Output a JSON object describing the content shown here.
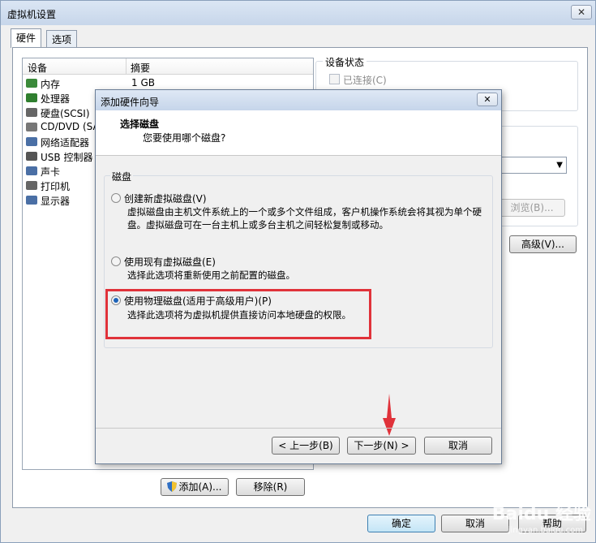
{
  "window": {
    "title": "虚拟机设置",
    "close_label": "✕"
  },
  "tabs": [
    {
      "label": "硬件"
    },
    {
      "label": "选项"
    }
  ],
  "device_list": {
    "headers": {
      "device": "设备",
      "summary": "摘要"
    },
    "items": [
      {
        "name": "内存",
        "summary": "1 GB",
        "icon": "memory-icon",
        "color": "#3a8a3a"
      },
      {
        "name": "处理器",
        "summary": "",
        "icon": "cpu-icon",
        "color": "#2f7f2f"
      },
      {
        "name": "硬盘(SCSI)",
        "summary": "",
        "icon": "harddisk-icon",
        "color": "#666666"
      },
      {
        "name": "CD/DVD (SA",
        "summary": "",
        "icon": "cdrom-icon",
        "color": "#777777"
      },
      {
        "name": "网络适配器",
        "summary": "",
        "icon": "network-icon",
        "color": "#4a6fa5"
      },
      {
        "name": "USB 控制器",
        "summary": "",
        "icon": "usb-icon",
        "color": "#555555"
      },
      {
        "name": "声卡",
        "summary": "",
        "icon": "speaker-icon",
        "color": "#4a6fa5"
      },
      {
        "name": "打印机",
        "summary": "",
        "icon": "printer-icon",
        "color": "#666666"
      },
      {
        "name": "显示器",
        "summary": "",
        "icon": "monitor-icon",
        "color": "#4a6fa5"
      }
    ]
  },
  "device_status": {
    "title": "设备状态",
    "connected_label": "已连接(C)"
  },
  "right_panel": {
    "browse_label": "浏览(B)...",
    "advanced_label": "高级(V)..."
  },
  "bottom_buttons": {
    "add_label": "添加(A)...",
    "remove_label": "移除(R)",
    "ok_label": "确定",
    "cancel_label": "取消",
    "help_label": "帮助"
  },
  "wizard": {
    "title": "添加硬件向导",
    "close_label": "✕",
    "heading": "选择磁盘",
    "subheading": "您要使用哪个磁盘?",
    "group_title": "磁盘",
    "options": [
      {
        "label": "创建新虚拟磁盘(V)",
        "desc": "虚拟磁盘由主机文件系统上的一个或多个文件组成，客户机操作系统会将其视为单个硬盘。虚拟磁盘可在一台主机上或多台主机之间轻松复制或移动。",
        "checked": false
      },
      {
        "label": "使用现有虚拟磁盘(E)",
        "desc": "选择此选项将重新使用之前配置的磁盘。",
        "checked": false
      },
      {
        "label": "使用物理磁盘(适用于高级用户)(P)",
        "desc": "选择此选项将为虚拟机提供直接访问本地硬盘的权限。",
        "checked": true
      }
    ],
    "back_label": "< 上一步(B)",
    "next_label": "下一步(N) >",
    "cancel_label": "取消"
  },
  "watermark": {
    "text": "Baidu 经验",
    "sub": "jingyan.baidu.com"
  },
  "colors": {
    "highlight": "#e0323a",
    "arrow": "#e0323a",
    "radio_dot": "#1d63b8"
  }
}
